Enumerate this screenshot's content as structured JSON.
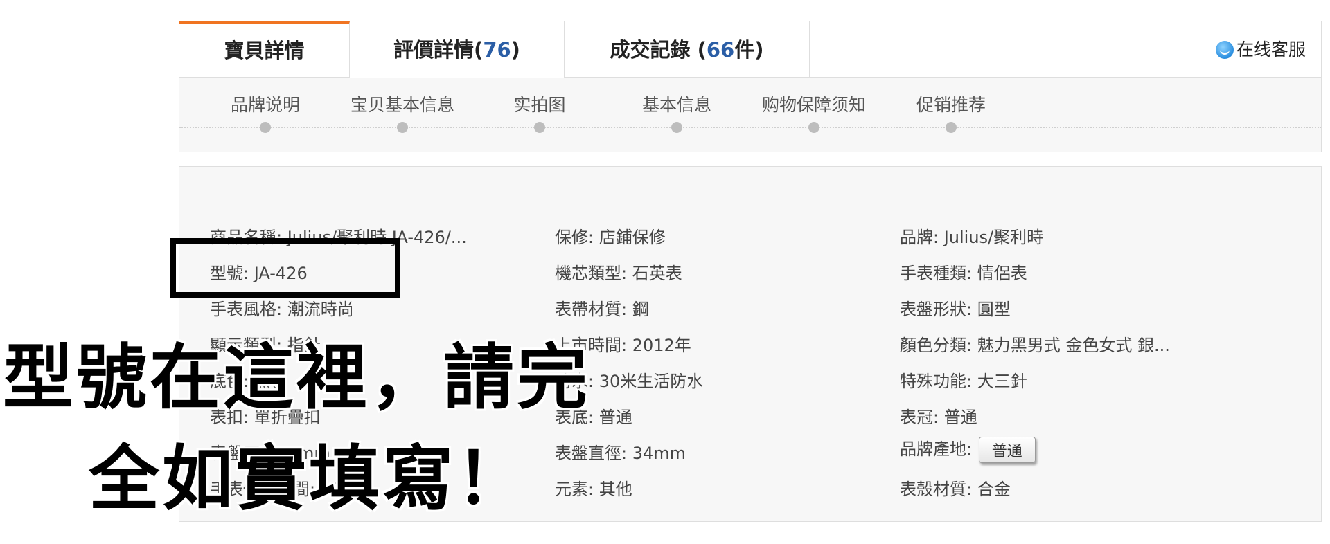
{
  "tabs": [
    {
      "label": "寶貝詳情",
      "count": ""
    },
    {
      "label": "評價詳情(",
      "count": "76",
      "suffix": ")"
    },
    {
      "label": "成交記錄 (",
      "count": "66",
      "suffix": "件)"
    }
  ],
  "service": {
    "label": "在线客服",
    "icon": "chat-bubble-icon"
  },
  "subnav": [
    "品牌说明",
    "宝贝基本信息",
    "实拍图",
    "基本信息",
    "购物保障须知",
    "促销推荐"
  ],
  "attributes": {
    "col1": [
      "商品名稱: Julius/聚利時 JA-426/...",
      "型號: JA-426",
      "手表風格: 潮流時尚",
      "顯示類型: 指針",
      "底色: 黑色",
      "表扣: 單折疊扣",
      "表盤厚度: 7mm",
      "手表價格區間: 200元"
    ],
    "col2": [
      "保修: 店鋪保修",
      "機芯類型: 石英表",
      "表帶材質: 鋼",
      "上市時間: 2012年",
      "防水: 30米生活防水",
      "表底: 普通",
      "表盤直徑: 34mm",
      "元素: 其他"
    ],
    "col3": [
      "品牌: Julius/聚利時",
      "手表種類: 情侶表",
      "表盤形狀: 圓型",
      "顏色分類: 魅力黑男式 金色女式 銀...",
      "特殊功能: 大三針",
      "表冠: 普通",
      "品牌產地:",
      "表殼材質: 合金"
    ],
    "origin_button": "普通"
  },
  "overlay": {
    "line1": "型號在這裡，請完",
    "line2": "全如實填寫！"
  },
  "colors": {
    "accent": "#f07421",
    "count": "#2b5ea6"
  }
}
